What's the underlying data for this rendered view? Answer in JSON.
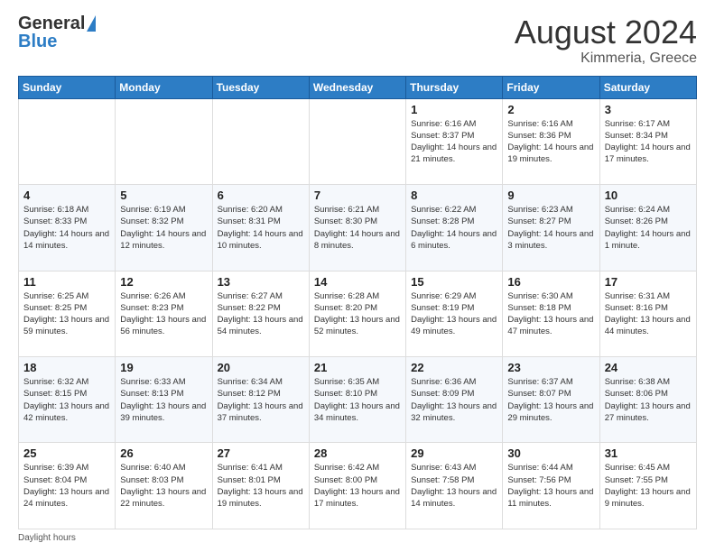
{
  "header": {
    "logo_general": "General",
    "logo_blue": "Blue",
    "month_year": "August 2024",
    "location": "Kimmeria, Greece"
  },
  "days_of_week": [
    "Sunday",
    "Monday",
    "Tuesday",
    "Wednesday",
    "Thursday",
    "Friday",
    "Saturday"
  ],
  "weeks": [
    [
      {
        "day": "",
        "info": ""
      },
      {
        "day": "",
        "info": ""
      },
      {
        "day": "",
        "info": ""
      },
      {
        "day": "",
        "info": ""
      },
      {
        "day": "1",
        "info": "Sunrise: 6:16 AM\nSunset: 8:37 PM\nDaylight: 14 hours and 21 minutes."
      },
      {
        "day": "2",
        "info": "Sunrise: 6:16 AM\nSunset: 8:36 PM\nDaylight: 14 hours and 19 minutes."
      },
      {
        "day": "3",
        "info": "Sunrise: 6:17 AM\nSunset: 8:34 PM\nDaylight: 14 hours and 17 minutes."
      }
    ],
    [
      {
        "day": "4",
        "info": "Sunrise: 6:18 AM\nSunset: 8:33 PM\nDaylight: 14 hours and 14 minutes."
      },
      {
        "day": "5",
        "info": "Sunrise: 6:19 AM\nSunset: 8:32 PM\nDaylight: 14 hours and 12 minutes."
      },
      {
        "day": "6",
        "info": "Sunrise: 6:20 AM\nSunset: 8:31 PM\nDaylight: 14 hours and 10 minutes."
      },
      {
        "day": "7",
        "info": "Sunrise: 6:21 AM\nSunset: 8:30 PM\nDaylight: 14 hours and 8 minutes."
      },
      {
        "day": "8",
        "info": "Sunrise: 6:22 AM\nSunset: 8:28 PM\nDaylight: 14 hours and 6 minutes."
      },
      {
        "day": "9",
        "info": "Sunrise: 6:23 AM\nSunset: 8:27 PM\nDaylight: 14 hours and 3 minutes."
      },
      {
        "day": "10",
        "info": "Sunrise: 6:24 AM\nSunset: 8:26 PM\nDaylight: 14 hours and 1 minute."
      }
    ],
    [
      {
        "day": "11",
        "info": "Sunrise: 6:25 AM\nSunset: 8:25 PM\nDaylight: 13 hours and 59 minutes."
      },
      {
        "day": "12",
        "info": "Sunrise: 6:26 AM\nSunset: 8:23 PM\nDaylight: 13 hours and 56 minutes."
      },
      {
        "day": "13",
        "info": "Sunrise: 6:27 AM\nSunset: 8:22 PM\nDaylight: 13 hours and 54 minutes."
      },
      {
        "day": "14",
        "info": "Sunrise: 6:28 AM\nSunset: 8:20 PM\nDaylight: 13 hours and 52 minutes."
      },
      {
        "day": "15",
        "info": "Sunrise: 6:29 AM\nSunset: 8:19 PM\nDaylight: 13 hours and 49 minutes."
      },
      {
        "day": "16",
        "info": "Sunrise: 6:30 AM\nSunset: 8:18 PM\nDaylight: 13 hours and 47 minutes."
      },
      {
        "day": "17",
        "info": "Sunrise: 6:31 AM\nSunset: 8:16 PM\nDaylight: 13 hours and 44 minutes."
      }
    ],
    [
      {
        "day": "18",
        "info": "Sunrise: 6:32 AM\nSunset: 8:15 PM\nDaylight: 13 hours and 42 minutes."
      },
      {
        "day": "19",
        "info": "Sunrise: 6:33 AM\nSunset: 8:13 PM\nDaylight: 13 hours and 39 minutes."
      },
      {
        "day": "20",
        "info": "Sunrise: 6:34 AM\nSunset: 8:12 PM\nDaylight: 13 hours and 37 minutes."
      },
      {
        "day": "21",
        "info": "Sunrise: 6:35 AM\nSunset: 8:10 PM\nDaylight: 13 hours and 34 minutes."
      },
      {
        "day": "22",
        "info": "Sunrise: 6:36 AM\nSunset: 8:09 PM\nDaylight: 13 hours and 32 minutes."
      },
      {
        "day": "23",
        "info": "Sunrise: 6:37 AM\nSunset: 8:07 PM\nDaylight: 13 hours and 29 minutes."
      },
      {
        "day": "24",
        "info": "Sunrise: 6:38 AM\nSunset: 8:06 PM\nDaylight: 13 hours and 27 minutes."
      }
    ],
    [
      {
        "day": "25",
        "info": "Sunrise: 6:39 AM\nSunset: 8:04 PM\nDaylight: 13 hours and 24 minutes."
      },
      {
        "day": "26",
        "info": "Sunrise: 6:40 AM\nSunset: 8:03 PM\nDaylight: 13 hours and 22 minutes."
      },
      {
        "day": "27",
        "info": "Sunrise: 6:41 AM\nSunset: 8:01 PM\nDaylight: 13 hours and 19 minutes."
      },
      {
        "day": "28",
        "info": "Sunrise: 6:42 AM\nSunset: 8:00 PM\nDaylight: 13 hours and 17 minutes."
      },
      {
        "day": "29",
        "info": "Sunrise: 6:43 AM\nSunset: 7:58 PM\nDaylight: 13 hours and 14 minutes."
      },
      {
        "day": "30",
        "info": "Sunrise: 6:44 AM\nSunset: 7:56 PM\nDaylight: 13 hours and 11 minutes."
      },
      {
        "day": "31",
        "info": "Sunrise: 6:45 AM\nSunset: 7:55 PM\nDaylight: 13 hours and 9 minutes."
      }
    ]
  ],
  "footer": {
    "daylight_label": "Daylight hours"
  }
}
